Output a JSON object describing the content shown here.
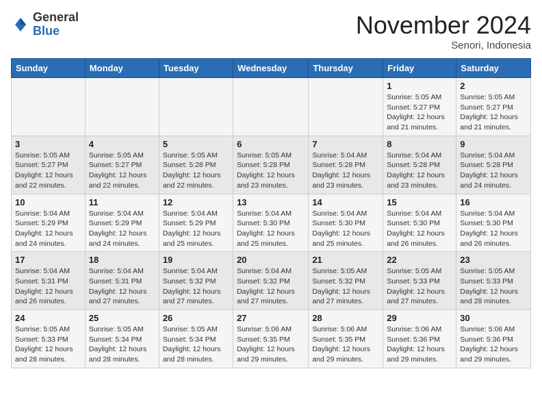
{
  "logo": {
    "general": "General",
    "blue": "Blue"
  },
  "header": {
    "month": "November 2024",
    "location": "Senori, Indonesia"
  },
  "weekdays": [
    "Sunday",
    "Monday",
    "Tuesday",
    "Wednesday",
    "Thursday",
    "Friday",
    "Saturday"
  ],
  "weeks": [
    [
      {
        "day": "",
        "info": ""
      },
      {
        "day": "",
        "info": ""
      },
      {
        "day": "",
        "info": ""
      },
      {
        "day": "",
        "info": ""
      },
      {
        "day": "",
        "info": ""
      },
      {
        "day": "1",
        "info": "Sunrise: 5:05 AM\nSunset: 5:27 PM\nDaylight: 12 hours\nand 21 minutes."
      },
      {
        "day": "2",
        "info": "Sunrise: 5:05 AM\nSunset: 5:27 PM\nDaylight: 12 hours\nand 21 minutes."
      }
    ],
    [
      {
        "day": "3",
        "info": "Sunrise: 5:05 AM\nSunset: 5:27 PM\nDaylight: 12 hours\nand 22 minutes."
      },
      {
        "day": "4",
        "info": "Sunrise: 5:05 AM\nSunset: 5:27 PM\nDaylight: 12 hours\nand 22 minutes."
      },
      {
        "day": "5",
        "info": "Sunrise: 5:05 AM\nSunset: 5:28 PM\nDaylight: 12 hours\nand 22 minutes."
      },
      {
        "day": "6",
        "info": "Sunrise: 5:05 AM\nSunset: 5:28 PM\nDaylight: 12 hours\nand 23 minutes."
      },
      {
        "day": "7",
        "info": "Sunrise: 5:04 AM\nSunset: 5:28 PM\nDaylight: 12 hours\nand 23 minutes."
      },
      {
        "day": "8",
        "info": "Sunrise: 5:04 AM\nSunset: 5:28 PM\nDaylight: 12 hours\nand 23 minutes."
      },
      {
        "day": "9",
        "info": "Sunrise: 5:04 AM\nSunset: 5:28 PM\nDaylight: 12 hours\nand 24 minutes."
      }
    ],
    [
      {
        "day": "10",
        "info": "Sunrise: 5:04 AM\nSunset: 5:29 PM\nDaylight: 12 hours\nand 24 minutes."
      },
      {
        "day": "11",
        "info": "Sunrise: 5:04 AM\nSunset: 5:29 PM\nDaylight: 12 hours\nand 24 minutes."
      },
      {
        "day": "12",
        "info": "Sunrise: 5:04 AM\nSunset: 5:29 PM\nDaylight: 12 hours\nand 25 minutes."
      },
      {
        "day": "13",
        "info": "Sunrise: 5:04 AM\nSunset: 5:30 PM\nDaylight: 12 hours\nand 25 minutes."
      },
      {
        "day": "14",
        "info": "Sunrise: 5:04 AM\nSunset: 5:30 PM\nDaylight: 12 hours\nand 25 minutes."
      },
      {
        "day": "15",
        "info": "Sunrise: 5:04 AM\nSunset: 5:30 PM\nDaylight: 12 hours\nand 26 minutes."
      },
      {
        "day": "16",
        "info": "Sunrise: 5:04 AM\nSunset: 5:30 PM\nDaylight: 12 hours\nand 26 minutes."
      }
    ],
    [
      {
        "day": "17",
        "info": "Sunrise: 5:04 AM\nSunset: 5:31 PM\nDaylight: 12 hours\nand 26 minutes."
      },
      {
        "day": "18",
        "info": "Sunrise: 5:04 AM\nSunset: 5:31 PM\nDaylight: 12 hours\nand 27 minutes."
      },
      {
        "day": "19",
        "info": "Sunrise: 5:04 AM\nSunset: 5:32 PM\nDaylight: 12 hours\nand 27 minutes."
      },
      {
        "day": "20",
        "info": "Sunrise: 5:04 AM\nSunset: 5:32 PM\nDaylight: 12 hours\nand 27 minutes."
      },
      {
        "day": "21",
        "info": "Sunrise: 5:05 AM\nSunset: 5:32 PM\nDaylight: 12 hours\nand 27 minutes."
      },
      {
        "day": "22",
        "info": "Sunrise: 5:05 AM\nSunset: 5:33 PM\nDaylight: 12 hours\nand 27 minutes."
      },
      {
        "day": "23",
        "info": "Sunrise: 5:05 AM\nSunset: 5:33 PM\nDaylight: 12 hours\nand 28 minutes."
      }
    ],
    [
      {
        "day": "24",
        "info": "Sunrise: 5:05 AM\nSunset: 5:33 PM\nDaylight: 12 hours\nand 28 minutes."
      },
      {
        "day": "25",
        "info": "Sunrise: 5:05 AM\nSunset: 5:34 PM\nDaylight: 12 hours\nand 28 minutes."
      },
      {
        "day": "26",
        "info": "Sunrise: 5:05 AM\nSunset: 5:34 PM\nDaylight: 12 hours\nand 28 minutes."
      },
      {
        "day": "27",
        "info": "Sunrise: 5:06 AM\nSunset: 5:35 PM\nDaylight: 12 hours\nand 29 minutes."
      },
      {
        "day": "28",
        "info": "Sunrise: 5:06 AM\nSunset: 5:35 PM\nDaylight: 12 hours\nand 29 minutes."
      },
      {
        "day": "29",
        "info": "Sunrise: 5:06 AM\nSunset: 5:36 PM\nDaylight: 12 hours\nand 29 minutes."
      },
      {
        "day": "30",
        "info": "Sunrise: 5:06 AM\nSunset: 5:36 PM\nDaylight: 12 hours\nand 29 minutes."
      }
    ]
  ]
}
